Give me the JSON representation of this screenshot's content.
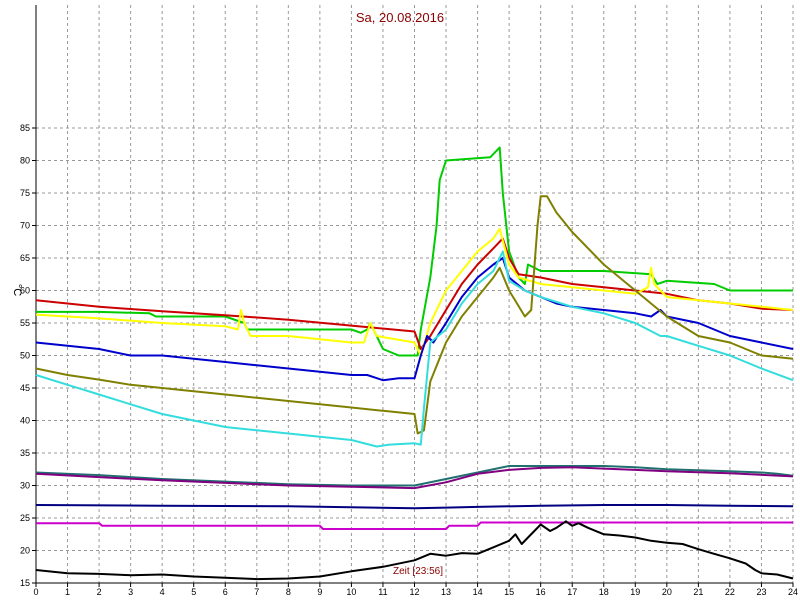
{
  "chart_data": {
    "type": "line",
    "title": "Sa, 20.08.2016",
    "xlabel": "Zeit [23:56]",
    "ylabel": "°C",
    "xlim": [
      0,
      24
    ],
    "ylim": [
      15,
      88
    ],
    "xticks": [
      0,
      1,
      2,
      3,
      4,
      5,
      6,
      7,
      8,
      9,
      10,
      11,
      12,
      13,
      14,
      15,
      16,
      17,
      18,
      19,
      20,
      21,
      22,
      23,
      24
    ],
    "yticks": [
      15,
      20,
      25,
      30,
      35,
      40,
      45,
      50,
      55,
      60,
      65,
      70,
      75,
      80,
      85
    ],
    "grid": true,
    "series": [
      {
        "color": "#00cc00",
        "points": [
          [
            0,
            56.7
          ],
          [
            2,
            56.7
          ],
          [
            3.6,
            56.5
          ],
          [
            3.8,
            56
          ],
          [
            6,
            56
          ],
          [
            6.6,
            55
          ],
          [
            6.7,
            54
          ],
          [
            10,
            54
          ],
          [
            10.3,
            53.5
          ],
          [
            10.5,
            54
          ],
          [
            10.6,
            55
          ],
          [
            11,
            51
          ],
          [
            11.5,
            50
          ],
          [
            12.1,
            50
          ],
          [
            12.2,
            54
          ],
          [
            12.5,
            62
          ],
          [
            12.7,
            70
          ],
          [
            12.8,
            77
          ],
          [
            13,
            80
          ],
          [
            14.4,
            80.5
          ],
          [
            14.6,
            81.5
          ],
          [
            14.7,
            82
          ],
          [
            14.8,
            75
          ],
          [
            15,
            66
          ],
          [
            15.3,
            62
          ],
          [
            15.5,
            61
          ],
          [
            15.6,
            64
          ],
          [
            16,
            63
          ],
          [
            18,
            63
          ],
          [
            19.5,
            62.5
          ],
          [
            19.7,
            61
          ],
          [
            20,
            61.5
          ],
          [
            21.5,
            61
          ],
          [
            22,
            60
          ],
          [
            24,
            60
          ]
        ]
      },
      {
        "color": "#cc0000",
        "points": [
          [
            0,
            58.5
          ],
          [
            2,
            57.5
          ],
          [
            4,
            56.8
          ],
          [
            6,
            56.2
          ],
          [
            8,
            55.5
          ],
          [
            10,
            54.6
          ],
          [
            12,
            53.7
          ],
          [
            12.2,
            51
          ],
          [
            12.5,
            53
          ],
          [
            13,
            57
          ],
          [
            13.5,
            61
          ],
          [
            14,
            64
          ],
          [
            14.5,
            66.5
          ],
          [
            14.8,
            68
          ],
          [
            15,
            65
          ],
          [
            15.3,
            62.5
          ],
          [
            16,
            62
          ],
          [
            17,
            61
          ],
          [
            18,
            60.5
          ],
          [
            19,
            60
          ],
          [
            20,
            59.5
          ],
          [
            21,
            58.5
          ],
          [
            22,
            58
          ],
          [
            23,
            57.2
          ],
          [
            24,
            57
          ]
        ]
      },
      {
        "color": "#ffff00",
        "points": [
          [
            0,
            56.3
          ],
          [
            2,
            55.7
          ],
          [
            4,
            55
          ],
          [
            6,
            54.5
          ],
          [
            6.4,
            54
          ],
          [
            6.5,
            57
          ],
          [
            6.6,
            55
          ],
          [
            6.8,
            53
          ],
          [
            8,
            53
          ],
          [
            10,
            52
          ],
          [
            10.4,
            52
          ],
          [
            10.6,
            55
          ],
          [
            10.8,
            53
          ],
          [
            12,
            52
          ],
          [
            12.2,
            50
          ],
          [
            12.5,
            55
          ],
          [
            13,
            60
          ],
          [
            13.5,
            63
          ],
          [
            14,
            66
          ],
          [
            14.5,
            68
          ],
          [
            14.7,
            69.5
          ],
          [
            15,
            64
          ],
          [
            15.3,
            62
          ],
          [
            16,
            61
          ],
          [
            17,
            60.5
          ],
          [
            18,
            60
          ],
          [
            19,
            59.5
          ],
          [
            19.4,
            60.5
          ],
          [
            19.5,
            63.5
          ],
          [
            19.6,
            61
          ],
          [
            20,
            59
          ],
          [
            22,
            58
          ],
          [
            24,
            57
          ]
        ]
      },
      {
        "color": "#0000cc",
        "points": [
          [
            0,
            52
          ],
          [
            1,
            51.5
          ],
          [
            2,
            51
          ],
          [
            3,
            50
          ],
          [
            4,
            50
          ],
          [
            5,
            49.5
          ],
          [
            6,
            49
          ],
          [
            7,
            48.5
          ],
          [
            8,
            48
          ],
          [
            9,
            47.5
          ],
          [
            10,
            47
          ],
          [
            10.5,
            47
          ],
          [
            11,
            46.2
          ],
          [
            11.5,
            46.5
          ],
          [
            12,
            46.5
          ],
          [
            12.2,
            50
          ],
          [
            12.4,
            53
          ],
          [
            12.6,
            52
          ],
          [
            13,
            55
          ],
          [
            13.5,
            59
          ],
          [
            14,
            62
          ],
          [
            14.5,
            64
          ],
          [
            14.8,
            65
          ],
          [
            15,
            62
          ],
          [
            15.5,
            60
          ],
          [
            16,
            59
          ],
          [
            16.5,
            58
          ],
          [
            17,
            57.5
          ],
          [
            18,
            57
          ],
          [
            19,
            56.5
          ],
          [
            19.5,
            56
          ],
          [
            19.8,
            57
          ],
          [
            20,
            56
          ],
          [
            21,
            55
          ],
          [
            22,
            53
          ],
          [
            23,
            52
          ],
          [
            24,
            51
          ]
        ]
      },
      {
        "color": "#808000",
        "points": [
          [
            0,
            48
          ],
          [
            1,
            47
          ],
          [
            2,
            46.3
          ],
          [
            3,
            45.5
          ],
          [
            4,
            45
          ],
          [
            5,
            44.5
          ],
          [
            6,
            44
          ],
          [
            7,
            43.5
          ],
          [
            8,
            43
          ],
          [
            9,
            42.5
          ],
          [
            10,
            42
          ],
          [
            11,
            41.5
          ],
          [
            12,
            41
          ],
          [
            12.1,
            38
          ],
          [
            12.3,
            38.5
          ],
          [
            12.5,
            46
          ],
          [
            13,
            52
          ],
          [
            13.5,
            56
          ],
          [
            14,
            59
          ],
          [
            14.5,
            62
          ],
          [
            14.7,
            63.5
          ],
          [
            15,
            60
          ],
          [
            15.5,
            56
          ],
          [
            15.7,
            57
          ],
          [
            15.9,
            70
          ],
          [
            16,
            74.5
          ],
          [
            16.2,
            74.5
          ],
          [
            16.5,
            72
          ],
          [
            17,
            69
          ],
          [
            18,
            64
          ],
          [
            19,
            60
          ],
          [
            20,
            56
          ],
          [
            21,
            53
          ],
          [
            22,
            52
          ],
          [
            23,
            50
          ],
          [
            24,
            49.5
          ]
        ]
      },
      {
        "color": "#33dddd",
        "points": [
          [
            0,
            47
          ],
          [
            1,
            45.5
          ],
          [
            2,
            44
          ],
          [
            3,
            42.5
          ],
          [
            4,
            41
          ],
          [
            5,
            40
          ],
          [
            6,
            39
          ],
          [
            7,
            38.5
          ],
          [
            8,
            38
          ],
          [
            9,
            37.5
          ],
          [
            10,
            37
          ],
          [
            10.8,
            36
          ],
          [
            11.2,
            36.3
          ],
          [
            12,
            36.5
          ],
          [
            12.2,
            36.3
          ],
          [
            12.3,
            42
          ],
          [
            12.5,
            52
          ],
          [
            13,
            54
          ],
          [
            13.5,
            58
          ],
          [
            14,
            61
          ],
          [
            14.5,
            63
          ],
          [
            14.8,
            66
          ],
          [
            15,
            61.5
          ],
          [
            15.5,
            60
          ],
          [
            16,
            59
          ],
          [
            17,
            57.5
          ],
          [
            18,
            56.5
          ],
          [
            19,
            55
          ],
          [
            19.8,
            53
          ],
          [
            20,
            53
          ],
          [
            21,
            51.5
          ],
          [
            22,
            50
          ],
          [
            23,
            48
          ],
          [
            24,
            46.2
          ]
        ]
      },
      {
        "color": "#207070",
        "points": [
          [
            0,
            32
          ],
          [
            2,
            31.6
          ],
          [
            4,
            31
          ],
          [
            6,
            30.6
          ],
          [
            8,
            30.2
          ],
          [
            10,
            30
          ],
          [
            12,
            30
          ],
          [
            13,
            31
          ],
          [
            14,
            32
          ],
          [
            15,
            33
          ],
          [
            16,
            33
          ],
          [
            18,
            33
          ],
          [
            19,
            32.8
          ],
          [
            20,
            32.5
          ],
          [
            22,
            32.2
          ],
          [
            23,
            32
          ],
          [
            23.5,
            31.8
          ],
          [
            24,
            31.5
          ]
        ]
      },
      {
        "color": "#800080",
        "points": [
          [
            0,
            31.8
          ],
          [
            2,
            31.3
          ],
          [
            4,
            30.8
          ],
          [
            6,
            30.4
          ],
          [
            8,
            30
          ],
          [
            10,
            29.8
          ],
          [
            12,
            29.6
          ],
          [
            13,
            30.5
          ],
          [
            14,
            31.8
          ],
          [
            15,
            32.4
          ],
          [
            16,
            32.7
          ],
          [
            17,
            32.8
          ],
          [
            18,
            32.6
          ],
          [
            19,
            32.4
          ],
          [
            20,
            32.2
          ],
          [
            22,
            31.9
          ],
          [
            24,
            31.4
          ]
        ]
      },
      {
        "color": "#000080",
        "points": [
          [
            0,
            27
          ],
          [
            4,
            26.9
          ],
          [
            8,
            26.8
          ],
          [
            12,
            26.5
          ],
          [
            13,
            26.6
          ],
          [
            14,
            26.7
          ],
          [
            16,
            26.9
          ],
          [
            18,
            27
          ],
          [
            20,
            27
          ],
          [
            22,
            26.9
          ],
          [
            24,
            26.8
          ]
        ]
      },
      {
        "color": "#cc00cc",
        "points": [
          [
            0,
            24.2
          ],
          [
            2,
            24.2
          ],
          [
            2.1,
            23.8
          ],
          [
            9,
            23.8
          ],
          [
            9.1,
            23.3
          ],
          [
            13,
            23.3
          ],
          [
            13.1,
            23.8
          ],
          [
            14,
            23.8
          ],
          [
            14.1,
            24.3
          ],
          [
            24,
            24.3
          ]
        ]
      },
      {
        "color": "#000000",
        "points": [
          [
            0,
            17
          ],
          [
            1,
            16.5
          ],
          [
            2,
            16.4
          ],
          [
            3,
            16.2
          ],
          [
            4,
            16.3
          ],
          [
            5,
            16
          ],
          [
            6,
            15.8
          ],
          [
            7,
            15.6
          ],
          [
            8,
            15.7
          ],
          [
            9,
            16
          ],
          [
            10,
            16.8
          ],
          [
            11,
            17.5
          ],
          [
            12,
            18.5
          ],
          [
            12.5,
            19.5
          ],
          [
            13,
            19.2
          ],
          [
            13.5,
            19.6
          ],
          [
            14,
            19.5
          ],
          [
            14.5,
            20.5
          ],
          [
            15,
            21.5
          ],
          [
            15.2,
            22.5
          ],
          [
            15.4,
            21
          ],
          [
            15.6,
            22
          ],
          [
            16,
            24
          ],
          [
            16.3,
            23
          ],
          [
            16.5,
            23.5
          ],
          [
            16.8,
            24.5
          ],
          [
            17,
            23.8
          ],
          [
            17.2,
            24.2
          ],
          [
            17.5,
            23.5
          ],
          [
            18,
            22.5
          ],
          [
            18.5,
            22.3
          ],
          [
            19,
            22
          ],
          [
            19.5,
            21.5
          ],
          [
            20,
            21.2
          ],
          [
            20.5,
            21
          ],
          [
            21,
            20.2
          ],
          [
            21.5,
            19.5
          ],
          [
            22,
            18.8
          ],
          [
            22.5,
            18
          ],
          [
            22.8,
            17
          ],
          [
            23,
            16.5
          ],
          [
            23.5,
            16.3
          ],
          [
            24,
            15.7
          ]
        ]
      }
    ]
  }
}
